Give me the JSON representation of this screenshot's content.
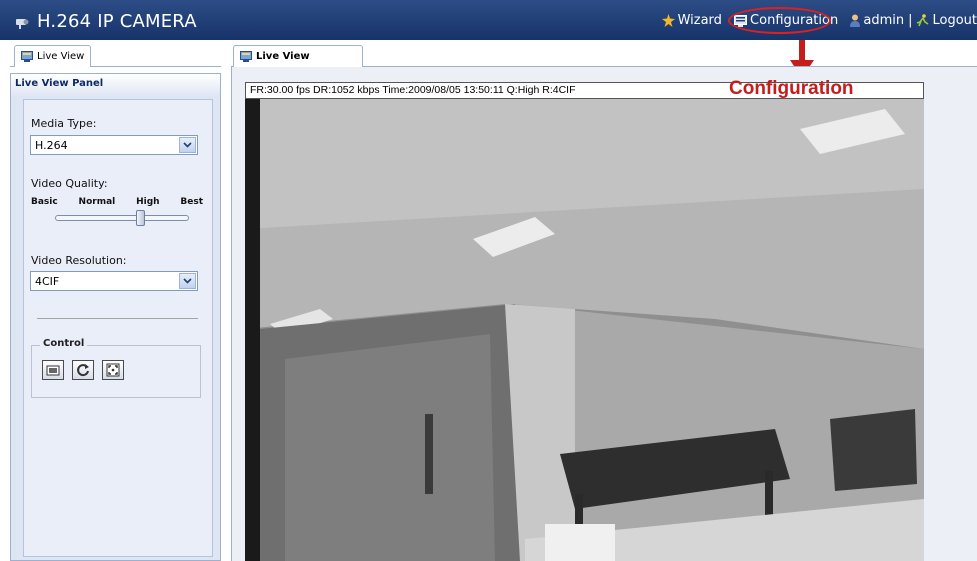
{
  "app": {
    "title": "H.264 IP CAMERA"
  },
  "top_nav": {
    "wizard": "Wizard",
    "configuration": "Configuration",
    "user": "admin",
    "separator": "|",
    "logout": "Logout"
  },
  "sidebar": {
    "tab_label": "Live View",
    "panel_title": "Live View Panel",
    "media_type": {
      "label": "Media Type:",
      "value": "H.264"
    },
    "video_quality": {
      "label": "Video Quality:",
      "levels": [
        "Basic",
        "Normal",
        "High",
        "Best"
      ],
      "selected": "High"
    },
    "video_resolution": {
      "label": "Video Resolution:",
      "value": "4CIF"
    },
    "control": {
      "legend": "Control",
      "buttons": [
        "snapshot-icon",
        "refresh-icon",
        "fullscreen-icon"
      ]
    }
  },
  "main": {
    "tab_label": "Live View",
    "status_text": "FR:30.00 fps  DR:1052 kbps Time:2009/08/05 13:50:11 Q:High R:4CIF",
    "callout": "Configuration"
  },
  "colors": {
    "header": "#1f3d76",
    "panel": "#dfe6f3",
    "callout": "#c51c1c"
  }
}
